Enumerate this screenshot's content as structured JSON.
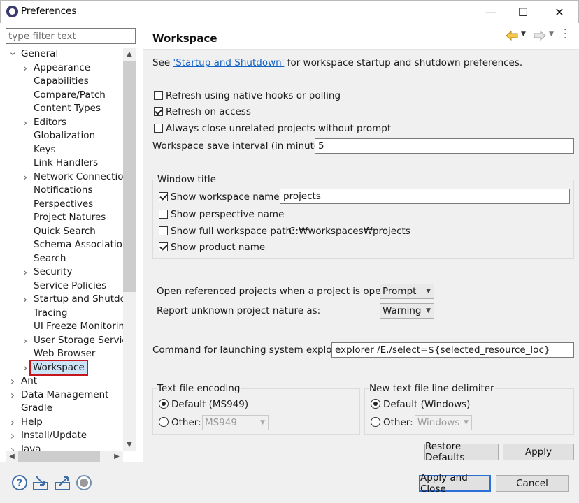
{
  "window": {
    "title": "Preferences",
    "min_glyph": "—",
    "max_glyph": "☐",
    "close_glyph": "✕"
  },
  "filter": {
    "placeholder": "type filter text"
  },
  "tree": {
    "items": [
      {
        "label": "General",
        "level": 0,
        "expander": "expanded"
      },
      {
        "label": "Appearance",
        "level": 1,
        "expander": "collapsed"
      },
      {
        "label": "Capabilities",
        "level": 1,
        "expander": "none"
      },
      {
        "label": "Compare/Patch",
        "level": 1,
        "expander": "none"
      },
      {
        "label": "Content Types",
        "level": 1,
        "expander": "none"
      },
      {
        "label": "Editors",
        "level": 1,
        "expander": "collapsed"
      },
      {
        "label": "Globalization",
        "level": 1,
        "expander": "none"
      },
      {
        "label": "Keys",
        "level": 1,
        "expander": "none"
      },
      {
        "label": "Link Handlers",
        "level": 1,
        "expander": "none"
      },
      {
        "label": "Network Connections",
        "level": 1,
        "expander": "collapsed"
      },
      {
        "label": "Notifications",
        "level": 1,
        "expander": "none"
      },
      {
        "label": "Perspectives",
        "level": 1,
        "expander": "none"
      },
      {
        "label": "Project Natures",
        "level": 1,
        "expander": "none"
      },
      {
        "label": "Quick Search",
        "level": 1,
        "expander": "none"
      },
      {
        "label": "Schema Associations",
        "level": 1,
        "expander": "none"
      },
      {
        "label": "Search",
        "level": 1,
        "expander": "none"
      },
      {
        "label": "Security",
        "level": 1,
        "expander": "collapsed"
      },
      {
        "label": "Service Policies",
        "level": 1,
        "expander": "none"
      },
      {
        "label": "Startup and Shutdown",
        "level": 1,
        "expander": "collapsed"
      },
      {
        "label": "Tracing",
        "level": 1,
        "expander": "none"
      },
      {
        "label": "UI Freeze Monitoring",
        "level": 1,
        "expander": "none"
      },
      {
        "label": "User Storage Service",
        "level": 1,
        "expander": "collapsed"
      },
      {
        "label": "Web Browser",
        "level": 1,
        "expander": "none"
      },
      {
        "label": "Workspace",
        "level": 1,
        "expander": "collapsed",
        "selected": true
      },
      {
        "label": "Ant",
        "level": 0,
        "expander": "collapsed"
      },
      {
        "label": "Data Management",
        "level": 0,
        "expander": "collapsed"
      },
      {
        "label": "Gradle",
        "level": 0,
        "expander": "none"
      },
      {
        "label": "Help",
        "level": 0,
        "expander": "collapsed"
      },
      {
        "label": "Install/Update",
        "level": 0,
        "expander": "collapsed"
      },
      {
        "label": "Java",
        "level": 0,
        "expander": "collapsed"
      }
    ]
  },
  "page": {
    "title": "Workspace",
    "intro_prefix": "See ",
    "intro_link": "'Startup and Shutdown'",
    "intro_suffix": " for workspace startup and shutdown preferences.",
    "refresh_native": {
      "label": "Refresh using native hooks or polling",
      "checked": false
    },
    "refresh_access": {
      "label": "Refresh on access",
      "checked": true
    },
    "always_close": {
      "label": "Always close unrelated projects without prompt",
      "checked": false
    },
    "save_interval": {
      "label": "Workspace save interval (in minutes):",
      "value": "5"
    },
    "window_title": {
      "label": "Window title",
      "show_workspace_name": {
        "label": "Show workspace name:",
        "checked": true,
        "value": "projects"
      },
      "show_perspective_name": {
        "label": "Show perspective name",
        "checked": false
      },
      "show_full_path": {
        "label": "Show full workspace path:",
        "checked": false,
        "value": "C:₩workspaces₩projects"
      },
      "show_product_name": {
        "label": "Show product name",
        "checked": true
      }
    },
    "open_referenced": {
      "label": "Open referenced projects when a project is opened:",
      "value": "Prompt"
    },
    "report_unknown": {
      "label": "Report unknown project nature as:",
      "value": "Warning"
    },
    "command": {
      "label": "Command for launching system explorer:",
      "value": "explorer /E,/select=${selected_resource_loc}"
    },
    "encoding": {
      "label": "Text file encoding",
      "default_label": "Default (MS949)",
      "other_label": "Other:",
      "other_value": "MS949",
      "selected": "default"
    },
    "line_delimiter": {
      "label": "New text file line delimiter",
      "default_label": "Default (Windows)",
      "other_label": "Other:",
      "other_value": "Windows",
      "selected": "default"
    },
    "restore_defaults": "Restore Defaults",
    "apply": "Apply"
  },
  "footer": {
    "apply_close": "Apply and Close",
    "cancel": "Cancel",
    "icons": [
      "help-icon",
      "import-icon",
      "export-icon",
      "record-icon"
    ]
  },
  "colors": {
    "selection_border": "#c4161c",
    "selection_bg": "#cce4f7",
    "link": "#1464c6"
  }
}
